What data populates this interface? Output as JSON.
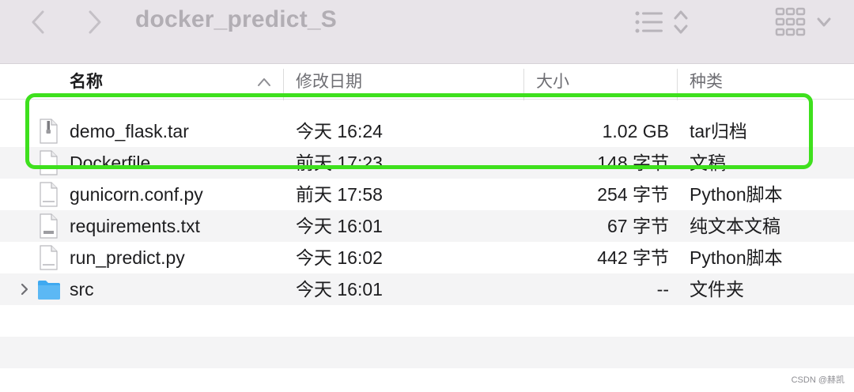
{
  "toolbar": {
    "title": "docker_predict_S",
    "back_icon": "chevron-left-icon",
    "forward_icon": "chevron-right-icon",
    "view_icons": [
      "list-view-icon",
      "sort-arrows-icon",
      "grid-view-icon",
      "chevron-down-icon"
    ]
  },
  "columns": {
    "name": "名称",
    "modified": "修改日期",
    "size": "大小",
    "kind": "种类",
    "sort_column": "名称",
    "sort_direction": "ascending"
  },
  "files": [
    {
      "name": "demo_flask.tar",
      "modified": "今天 16:24",
      "size": "1.02 GB",
      "kind": "tar归档",
      "icon": "archive-icon"
    },
    {
      "name": "Dockerfile",
      "modified": "前天 17:23",
      "size": "148 字节",
      "kind": "文稿",
      "icon": "document-icon"
    },
    {
      "name": "gunicorn.conf.py",
      "modified": "前天 17:58",
      "size": "254 字节",
      "kind": "Python脚本",
      "icon": "python-file-icon"
    },
    {
      "name": "requirements.txt",
      "modified": "今天 16:01",
      "size": "67 字节",
      "kind": "纯文本文稿",
      "icon": "text-file-icon"
    },
    {
      "name": "run_predict.py",
      "modified": "今天 16:02",
      "size": "442 字节",
      "kind": "Python脚本",
      "icon": "python-file-icon"
    },
    {
      "name": "src",
      "modified": "今天 16:01",
      "size": "--",
      "kind": "文件夹",
      "icon": "folder-icon"
    }
  ],
  "highlighted_file": "demo_flask.tar",
  "highlight_color": "#3ee01d",
  "folder_color": "#3fa9f0",
  "watermark": "CSDN @赫凯"
}
